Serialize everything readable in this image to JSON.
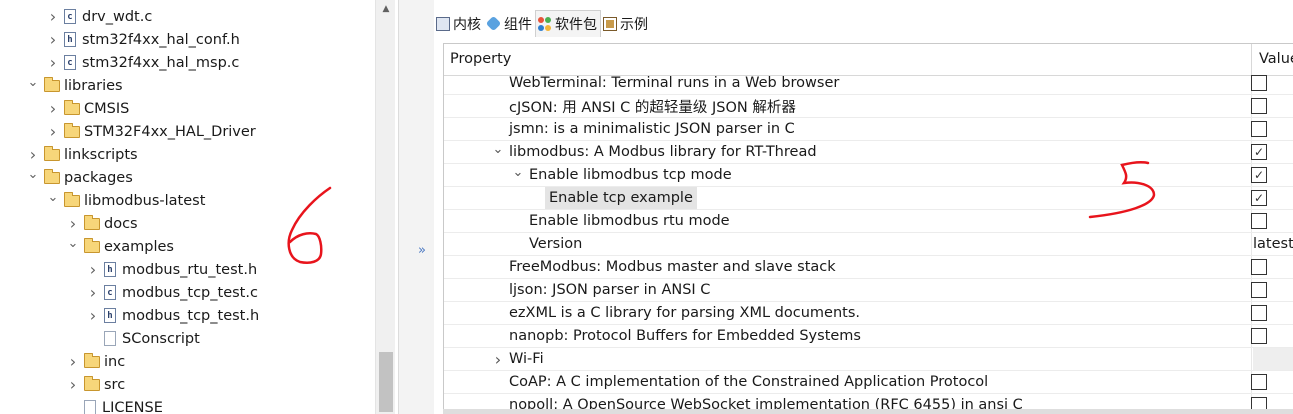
{
  "tree": {
    "items": [
      {
        "label": "drv_wdt.c",
        "icon": "c-file-icon",
        "level": 2,
        "expander": "collapsed"
      },
      {
        "label": "stm32f4xx_hal_conf.h",
        "icon": "h-file-icon",
        "level": 2,
        "expander": "collapsed"
      },
      {
        "label": "stm32f4xx_hal_msp.c",
        "icon": "c-file-icon",
        "level": 2,
        "expander": "collapsed"
      },
      {
        "label": "libraries",
        "icon": "folder-icon",
        "level": 1,
        "expander": "expanded"
      },
      {
        "label": "CMSIS",
        "icon": "folder-icon",
        "level": 2,
        "expander": "collapsed"
      },
      {
        "label": "STM32F4xx_HAL_Driver",
        "icon": "folder-icon",
        "level": 2,
        "expander": "collapsed"
      },
      {
        "label": "linkscripts",
        "icon": "folder-icon",
        "level": 1,
        "expander": "collapsed"
      },
      {
        "label": "packages",
        "icon": "folder-icon",
        "level": 1,
        "expander": "expanded"
      },
      {
        "label": "libmodbus-latest",
        "icon": "folder-icon",
        "level": 2,
        "expander": "expanded"
      },
      {
        "label": "docs",
        "icon": "folder-icon",
        "level": 3,
        "expander": "collapsed"
      },
      {
        "label": "examples",
        "icon": "folder-icon",
        "level": 3,
        "expander": "expanded"
      },
      {
        "label": "modbus_rtu_test.h",
        "icon": "h-file-icon",
        "level": 4,
        "expander": "collapsed"
      },
      {
        "label": "modbus_tcp_test.c",
        "icon": "c-file-icon",
        "level": 4,
        "expander": "collapsed"
      },
      {
        "label": "modbus_tcp_test.h",
        "icon": "h-file-icon",
        "level": 4,
        "expander": "collapsed"
      },
      {
        "label": "SConscript",
        "icon": "plain-file-icon",
        "level": 4,
        "expander": "none"
      },
      {
        "label": "inc",
        "icon": "folder-icon",
        "level": 3,
        "expander": "collapsed"
      },
      {
        "label": "src",
        "icon": "folder-icon",
        "level": 3,
        "expander": "collapsed"
      },
      {
        "label": "LICENSE",
        "icon": "plain-file-icon",
        "level": 3,
        "expander": "none"
      }
    ]
  },
  "tabs": [
    {
      "label": "内核",
      "icon": "kernel-icon",
      "active": false
    },
    {
      "label": "组件",
      "icon": "component-icon",
      "active": false
    },
    {
      "label": "软件包",
      "icon": "package-icon",
      "active": true
    },
    {
      "label": "示例",
      "icon": "sample-icon",
      "active": false
    }
  ],
  "collapse_glyph": "»",
  "table": {
    "header_property": "Property",
    "header_value": "Value",
    "rows": [
      {
        "label": "WebTerminal: Terminal runs in a Web browser",
        "level": 0,
        "expander": "none",
        "value": "unchecked"
      },
      {
        "label": "cJSON: 用 ANSI C 的超轻量级 JSON 解析器",
        "level": 0,
        "expander": "none",
        "value": "unchecked"
      },
      {
        "label": "jsmn: is a minimalistic JSON parser in C",
        "level": 0,
        "expander": "none",
        "value": "unchecked"
      },
      {
        "label": "libmodbus: A Modbus library for RT-Thread",
        "level": 0,
        "expander": "expanded",
        "value": "checked"
      },
      {
        "label": "Enable libmodbus tcp mode",
        "level": 1,
        "expander": "expanded",
        "value": "checked"
      },
      {
        "label": "Enable tcp example",
        "level": 2,
        "expander": "none",
        "value": "checked",
        "selected": true
      },
      {
        "label": "Enable libmodbus rtu mode",
        "level": 1,
        "expander": "none",
        "value": "unchecked"
      },
      {
        "label": "Version",
        "level": 1,
        "expander": "none",
        "value": "text",
        "value_text": "latest"
      },
      {
        "label": "FreeModbus: Modbus master and slave stack",
        "level": 0,
        "expander": "none",
        "value": "unchecked"
      },
      {
        "label": "ljson: JSON parser in ANSI C",
        "level": 0,
        "expander": "none",
        "value": "unchecked"
      },
      {
        "label": "ezXML is a C library for parsing XML documents.",
        "level": 0,
        "expander": "none",
        "value": "unchecked"
      },
      {
        "label": "nanopb: Protocol Buffers for Embedded Systems",
        "level": 0,
        "expander": "none",
        "value": "unchecked"
      },
      {
        "label": "Wi-Fi",
        "level": 0,
        "expander": "collapsed",
        "value": "group"
      },
      {
        "label": "CoAP: A C implementation of the Constrained Application Protocol",
        "level": 0,
        "expander": "none",
        "value": "unchecked"
      },
      {
        "label": "nopoll: A OpenSource WebSocket implementation (RFC 6455) in ansi C",
        "level": 0,
        "expander": "none",
        "value": "unchecked"
      }
    ]
  },
  "colors": {
    "annotation_red": "#e8141c",
    "selection_bg": "#e4e4e4",
    "collapse_blue": "#4a78c2"
  }
}
